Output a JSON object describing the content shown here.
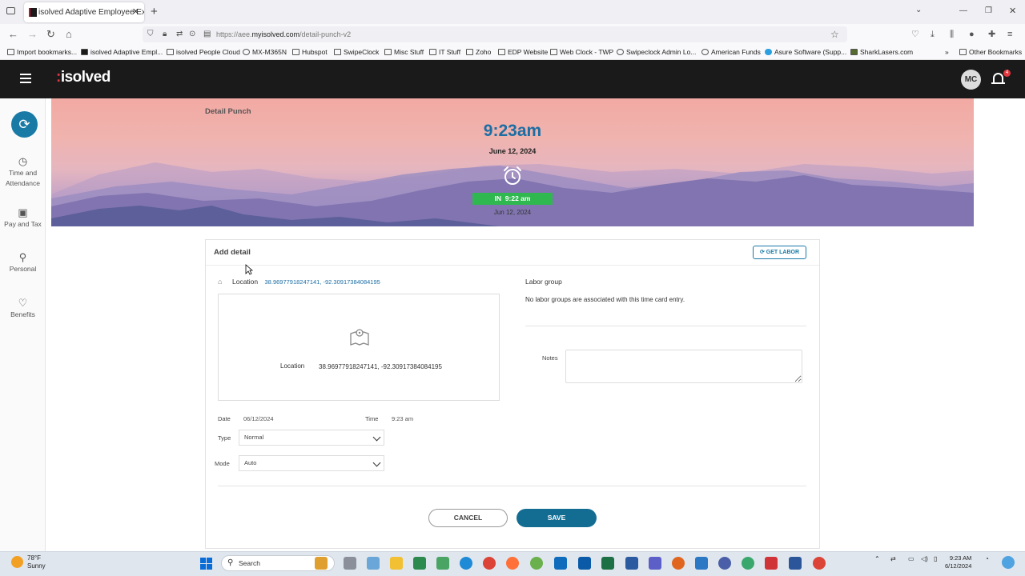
{
  "browser": {
    "tab_title": "isolved Adaptive Employee Exp",
    "url_prefix": "https://aee.",
    "url_domain": "myisolved.com",
    "url_path": "/detail-punch-v2",
    "bookmarks": [
      "Import bookmarks...",
      "isolved Adaptive Empl...",
      "isolved People Cloud",
      "MX-M365N",
      "Hubspot",
      "SwipeClock",
      "Misc Stuff",
      "IT Stuff",
      "Zoho",
      "EDP Website",
      "Web Clock - TWP",
      "Swipeclock Admin Lo...",
      "American Funds",
      "Asure Software (Supp...",
      "SharkLasers.com",
      "Other Bookmarks"
    ]
  },
  "app": {
    "logo": "isolved",
    "avatar_initials": "MC",
    "notification_count": "4"
  },
  "sidebar": {
    "items": [
      {
        "label_line1": "Time and",
        "label_line2": "Attendance"
      },
      {
        "label_line1": "Pay and Tax",
        "label_line2": ""
      },
      {
        "label_line1": "Personal",
        "label_line2": ""
      },
      {
        "label_line1": "Benefits",
        "label_line2": ""
      }
    ]
  },
  "banner": {
    "title": "Detail Punch",
    "time": "9:23am",
    "date": "June 12, 2024",
    "punch_label": "IN",
    "punch_time": "9:22 am",
    "punch_date": "Jun 12, 2024"
  },
  "card": {
    "title": "Add detail",
    "get_labor_label": "GET LABOR",
    "location_label": "Location",
    "location_value": "38.96977918247141, -92.30917384084195",
    "map_location_label": "Location",
    "map_location_value": "38.96977918247141, -92.30917384084195",
    "labor_group_title": "Labor group",
    "labor_group_text": "No labor groups are associated with this time card entry.",
    "notes_label": "Notes",
    "date_label": "Date",
    "date_value": "06/12/2024",
    "time_label": "Time",
    "time_value": "9:23 am",
    "type_label": "Type",
    "type_value": "Normal",
    "mode_label": "Mode",
    "mode_value": "Auto",
    "cancel_label": "CANCEL",
    "save_label": "SAVE"
  },
  "taskbar": {
    "temperature": "78°F",
    "condition": "Sunny",
    "search_placeholder": "Search",
    "time": "9:23 AM",
    "date": "6/12/2024"
  }
}
